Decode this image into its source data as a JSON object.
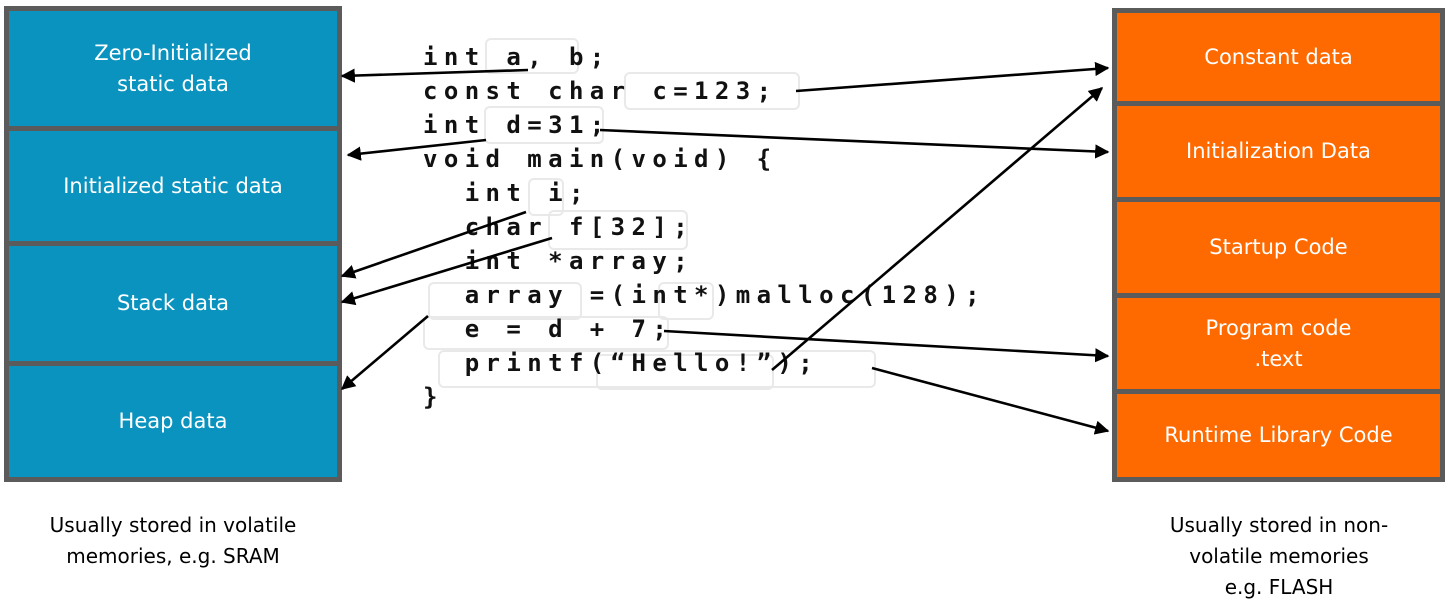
{
  "left_memory": {
    "blocks": [
      {
        "id": "zero-init",
        "label": "Zero-Initialized\nstatic data"
      },
      {
        "id": "init-static",
        "label": "Initialized static data"
      },
      {
        "id": "stack",
        "label": "Stack data"
      },
      {
        "id": "heap",
        "label": "Heap data"
      }
    ],
    "caption": "Usually stored in volatile\nmemories, e.g. SRAM"
  },
  "right_memory": {
    "blocks": [
      {
        "id": "constant",
        "label": "Constant data"
      },
      {
        "id": "init-data",
        "label": "Initialization Data"
      },
      {
        "id": "startup",
        "label": "Startup Code"
      },
      {
        "id": "program",
        "label": "Program code\n.text"
      },
      {
        "id": "runtime-lib",
        "label": "Runtime Library Code"
      }
    ],
    "caption": "Usually stored in non-\nvolatile memories\ne.g. FLASH"
  },
  "code": {
    "lines": [
      "int a, b;",
      "const char c=123;",
      "int d=31;",
      "void main(void) {",
      "  int i;",
      "  char f[32];",
      "  int *array;",
      "  array =(int*)malloc(128);",
      "  e = d + 7;",
      "  printf(“Hello!”);",
      "}"
    ]
  },
  "colors": {
    "volatile_block": "#0a93be",
    "non_volatile_block": "#ff6a00",
    "frame": "#5b5b5b",
    "arrow": "#000000"
  }
}
